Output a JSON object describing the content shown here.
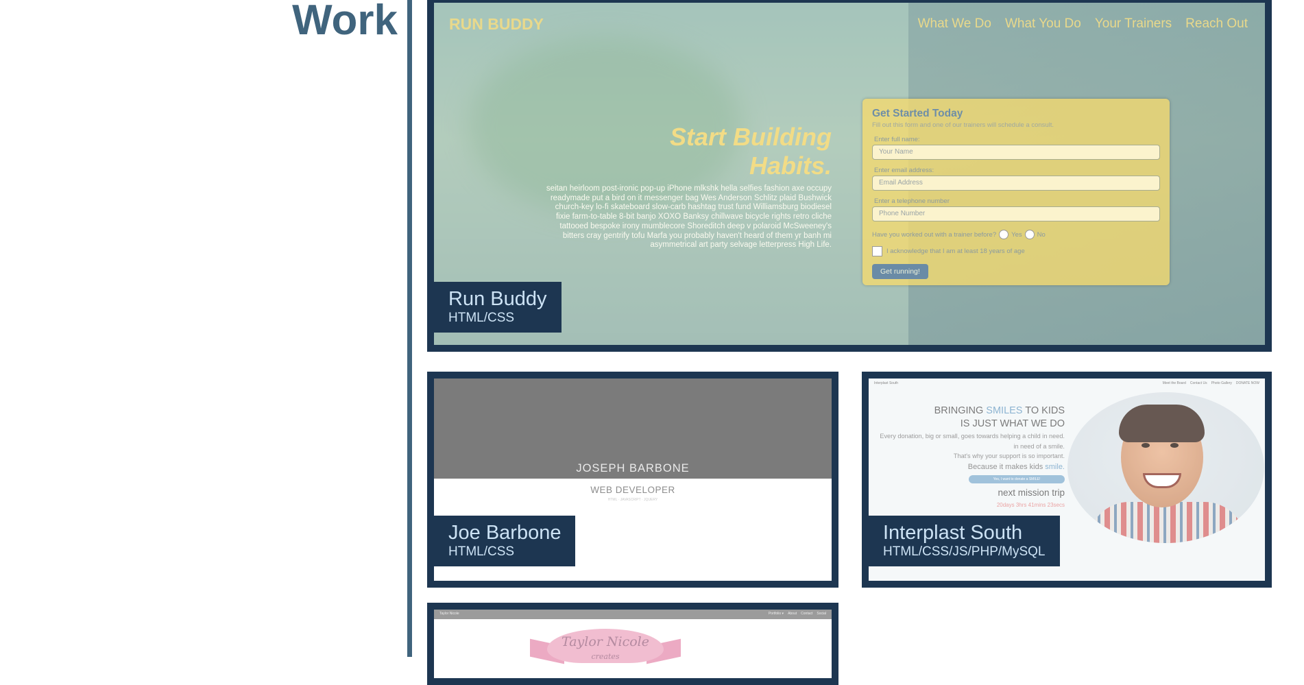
{
  "section": {
    "heading": "Work"
  },
  "projects": [
    {
      "title": "Run Buddy",
      "tech": "HTML/CSS"
    },
    {
      "title": "Joe Barbone",
      "tech": "HTML/CSS"
    },
    {
      "title": "Interplast South",
      "tech": "HTML/CSS/JS/PHP/MySQL"
    }
  ],
  "run_buddy": {
    "logo": "RUN BUDDY",
    "nav": [
      "What We Do",
      "What You Do",
      "Your Trainers",
      "Reach Out"
    ],
    "hero_title_1": "Start Building",
    "hero_title_2": "Habits.",
    "hero_text": "seitan heirloom post-ironic pop-up iPhone mlkshk hella selfies fashion axe occupy readymade put a bird on it messenger bag Wes Anderson Schlitz plaid Bushwick church-key lo-fi skateboard slow-carb hashtag trust fund Williamsburg biodiesel fixie farm-to-table 8-bit banjo XOXO Banksy chillwave bicycle rights retro cliche tattooed bespoke irony mumblecore Shoreditch deep v polaroid McSweeney's bitters cray gentrify tofu Marfa you probably haven't heard of them yr banh mi asymmetrical art party selvage letterpress High Life.",
    "form": {
      "title": "Get Started Today",
      "subtitle": "Fill out this form and one of our trainers will schedule a consult.",
      "name_label": "Enter full name:",
      "name_placeholder": "Your Name",
      "email_label": "Enter email address:",
      "email_placeholder": "Email Address",
      "phone_label": "Enter a telephone number",
      "phone_placeholder": "Phone Number",
      "radio_question": "Have you worked out with a trainer before?",
      "radio_yes": "Yes",
      "radio_no": "No",
      "checkbox_label": "I acknowledge that I am at least 18 years of age",
      "submit": "Get running!"
    }
  },
  "joe_barbone": {
    "name": "JOSEPH BARBONE",
    "role": "WEB DEVELOPER",
    "tiny": "HTML · JAVASCRIPT · JQUERY"
  },
  "interplast": {
    "site_name": "Interplast South",
    "nav": [
      "Meet the Board",
      "Contact Us",
      "Photo Gallery",
      "DONATE NOW"
    ],
    "headline_pre": "BRINGING ",
    "headline_em": "SMILES",
    "headline_post": " TO KIDS",
    "headline_2": "IS JUST WHAT WE DO",
    "body_1": "Every donation, big or small, goes towards helping a child in need.",
    "body_2": "in need of a smile.",
    "body_3": "That's why your support is so important.",
    "because": "Because it makes kids ",
    "because_em": "smile.",
    "cta": "Yes, I want to donate a SMILE!",
    "mission": "next mission trip",
    "countdown": "20days 3hrs 41mins 23secs"
  },
  "taylor": {
    "site_name": "Taylor Nicole",
    "nav": [
      "Portfolio ▾",
      "About",
      "Contact",
      "Social"
    ],
    "logo_text": "Taylor Nicole",
    "logo_sub": "creates"
  }
}
